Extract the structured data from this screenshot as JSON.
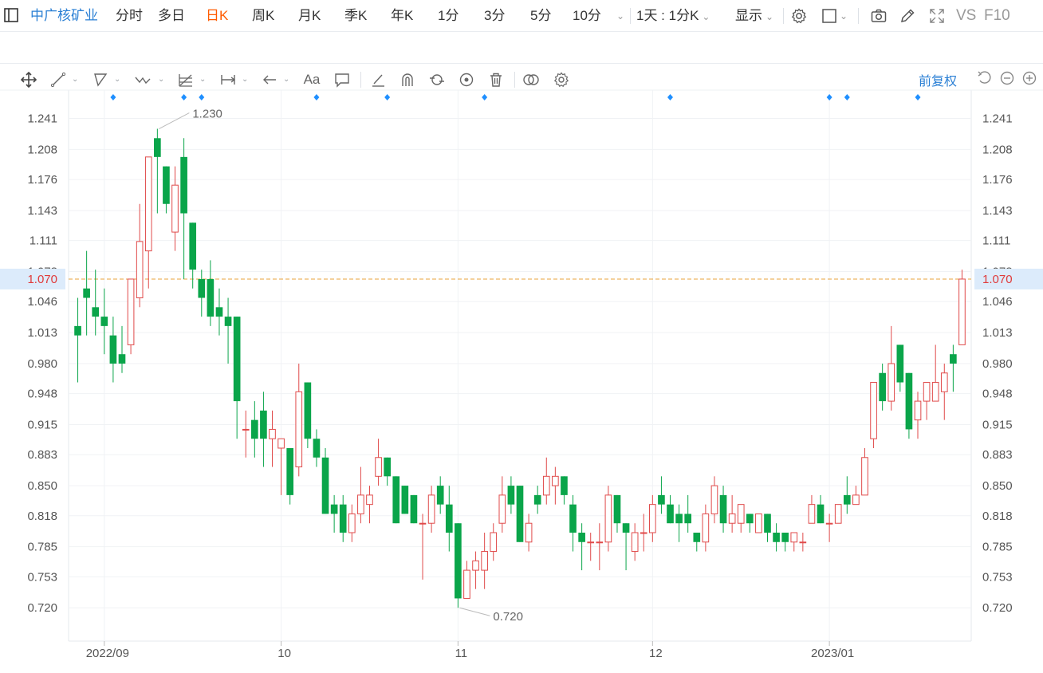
{
  "header": {
    "stock_name": "中广核矿业",
    "periods": [
      "分时",
      "多日",
      "日K",
      "周K",
      "月K",
      "季K",
      "年K",
      "1分",
      "3分",
      "5分",
      "10分"
    ],
    "active_period": "日K",
    "interval_label": "1天 : 1分K",
    "display_label": "显示",
    "vs_label": "VS",
    "f10_label": "F10"
  },
  "toolbar2_icons": [
    "crosshair-move-icon",
    "line-tool-icon",
    "polyline-tool-icon",
    "wave-tool-icon",
    "fib-tool-icon",
    "measure-tool-icon",
    "arrow-tool-icon",
    "text-tool-icon",
    "comment-tool-icon",
    "brush-tool-icon",
    "magnet-tool-icon",
    "sync-tool-icon",
    "eye-icon",
    "trash-icon",
    "compare-icon",
    "settings-icon"
  ],
  "adjust_label": "前复权",
  "chart_data": {
    "type": "candlestick",
    "title": "",
    "ylim": [
      0.71,
      1.261
    ],
    "yticks": [
      "1.241",
      "1.208",
      "1.176",
      "1.143",
      "1.111",
      "1.078",
      "1.046",
      "1.013",
      "0.980",
      "0.948",
      "0.915",
      "0.883",
      "0.850",
      "0.818",
      "0.785",
      "0.753",
      "0.720"
    ],
    "x_labels": [
      {
        "index": 3,
        "label": "2022/09"
      },
      {
        "index": 23,
        "label": "10"
      },
      {
        "index": 43,
        "label": "11"
      },
      {
        "index": 65,
        "label": "12"
      },
      {
        "index": 85,
        "label": "2023/01"
      }
    ],
    "current_price": "1.070",
    "annotations": [
      {
        "label": "1.230",
        "index": 9,
        "value": 1.23
      },
      {
        "label": "0.720",
        "index": 43,
        "value": 0.72
      }
    ],
    "event_marker_indices": [
      4,
      12,
      14,
      27,
      35,
      46,
      67,
      85,
      87,
      95
    ],
    "colors": {
      "up": "#e04a4a",
      "down": "#0aa54a",
      "current_line": "#e8a33b",
      "current_bg": "#dcebfb"
    },
    "candles": [
      {
        "o": 1.02,
        "h": 1.05,
        "l": 0.96,
        "c": 1.01
      },
      {
        "o": 1.06,
        "h": 1.1,
        "l": 1.01,
        "c": 1.05
      },
      {
        "o": 1.04,
        "h": 1.08,
        "l": 1.01,
        "c": 1.03
      },
      {
        "o": 1.03,
        "h": 1.06,
        "l": 0.99,
        "c": 1.02
      },
      {
        "o": 1.01,
        "h": 1.03,
        "l": 0.96,
        "c": 0.98
      },
      {
        "o": 0.99,
        "h": 1.02,
        "l": 0.97,
        "c": 0.98
      },
      {
        "o": 1.0,
        "h": 1.07,
        "l": 0.99,
        "c": 1.07
      },
      {
        "o": 1.05,
        "h": 1.15,
        "l": 1.04,
        "c": 1.11
      },
      {
        "o": 1.1,
        "h": 1.2,
        "l": 1.06,
        "c": 1.2
      },
      {
        "o": 1.22,
        "h": 1.23,
        "l": 1.14,
        "c": 1.2
      },
      {
        "o": 1.19,
        "h": 1.19,
        "l": 1.14,
        "c": 1.15
      },
      {
        "o": 1.12,
        "h": 1.19,
        "l": 1.1,
        "c": 1.17
      },
      {
        "o": 1.2,
        "h": 1.22,
        "l": 1.07,
        "c": 1.14
      },
      {
        "o": 1.13,
        "h": 1.13,
        "l": 1.06,
        "c": 1.08
      },
      {
        "o": 1.07,
        "h": 1.08,
        "l": 1.03,
        "c": 1.05
      },
      {
        "o": 1.07,
        "h": 1.09,
        "l": 1.02,
        "c": 1.03
      },
      {
        "o": 1.04,
        "h": 1.06,
        "l": 1.01,
        "c": 1.03
      },
      {
        "o": 1.03,
        "h": 1.05,
        "l": 0.98,
        "c": 1.02
      },
      {
        "o": 1.03,
        "h": 1.03,
        "l": 0.9,
        "c": 0.94
      },
      {
        "o": 0.91,
        "h": 0.93,
        "l": 0.88,
        "c": 0.91
      },
      {
        "o": 0.92,
        "h": 0.94,
        "l": 0.88,
        "c": 0.9
      },
      {
        "o": 0.93,
        "h": 0.95,
        "l": 0.87,
        "c": 0.9
      },
      {
        "o": 0.9,
        "h": 0.93,
        "l": 0.87,
        "c": 0.91
      },
      {
        "o": 0.89,
        "h": 0.9,
        "l": 0.84,
        "c": 0.9
      },
      {
        "o": 0.89,
        "h": 0.89,
        "l": 0.83,
        "c": 0.84
      },
      {
        "o": 0.87,
        "h": 0.98,
        "l": 0.86,
        "c": 0.95
      },
      {
        "o": 0.96,
        "h": 0.96,
        "l": 0.89,
        "c": 0.9
      },
      {
        "o": 0.9,
        "h": 0.91,
        "l": 0.87,
        "c": 0.88
      },
      {
        "o": 0.88,
        "h": 0.89,
        "l": 0.82,
        "c": 0.82
      },
      {
        "o": 0.83,
        "h": 0.84,
        "l": 0.8,
        "c": 0.82
      },
      {
        "o": 0.83,
        "h": 0.84,
        "l": 0.79,
        "c": 0.8
      },
      {
        "o": 0.8,
        "h": 0.83,
        "l": 0.79,
        "c": 0.82
      },
      {
        "o": 0.82,
        "h": 0.87,
        "l": 0.81,
        "c": 0.84
      },
      {
        "o": 0.83,
        "h": 0.85,
        "l": 0.81,
        "c": 0.84
      },
      {
        "o": 0.86,
        "h": 0.9,
        "l": 0.85,
        "c": 0.88
      },
      {
        "o": 0.88,
        "h": 0.88,
        "l": 0.85,
        "c": 0.86
      },
      {
        "o": 0.86,
        "h": 0.86,
        "l": 0.81,
        "c": 0.81
      },
      {
        "o": 0.85,
        "h": 0.85,
        "l": 0.82,
        "c": 0.82
      },
      {
        "o": 0.84,
        "h": 0.84,
        "l": 0.81,
        "c": 0.81
      },
      {
        "o": 0.81,
        "h": 0.82,
        "l": 0.75,
        "c": 0.81
      },
      {
        "o": 0.81,
        "h": 0.85,
        "l": 0.8,
        "c": 0.84
      },
      {
        "o": 0.85,
        "h": 0.86,
        "l": 0.82,
        "c": 0.83
      },
      {
        "o": 0.83,
        "h": 0.85,
        "l": 0.78,
        "c": 0.8
      },
      {
        "o": 0.81,
        "h": 0.81,
        "l": 0.72,
        "c": 0.73
      },
      {
        "o": 0.73,
        "h": 0.77,
        "l": 0.73,
        "c": 0.76
      },
      {
        "o": 0.76,
        "h": 0.78,
        "l": 0.74,
        "c": 0.77
      },
      {
        "o": 0.76,
        "h": 0.8,
        "l": 0.74,
        "c": 0.78
      },
      {
        "o": 0.78,
        "h": 0.81,
        "l": 0.77,
        "c": 0.8
      },
      {
        "o": 0.81,
        "h": 0.86,
        "l": 0.8,
        "c": 0.84
      },
      {
        "o": 0.85,
        "h": 0.86,
        "l": 0.82,
        "c": 0.83
      },
      {
        "o": 0.85,
        "h": 0.85,
        "l": 0.79,
        "c": 0.79
      },
      {
        "o": 0.79,
        "h": 0.82,
        "l": 0.78,
        "c": 0.81
      },
      {
        "o": 0.84,
        "h": 0.85,
        "l": 0.82,
        "c": 0.83
      },
      {
        "o": 0.84,
        "h": 0.88,
        "l": 0.83,
        "c": 0.86
      },
      {
        "o": 0.85,
        "h": 0.87,
        "l": 0.83,
        "c": 0.86
      },
      {
        "o": 0.86,
        "h": 0.86,
        "l": 0.83,
        "c": 0.84
      },
      {
        "o": 0.83,
        "h": 0.84,
        "l": 0.78,
        "c": 0.8
      },
      {
        "o": 0.8,
        "h": 0.81,
        "l": 0.76,
        "c": 0.79
      },
      {
        "o": 0.79,
        "h": 0.8,
        "l": 0.77,
        "c": 0.79
      },
      {
        "o": 0.79,
        "h": 0.81,
        "l": 0.76,
        "c": 0.79
      },
      {
        "o": 0.79,
        "h": 0.85,
        "l": 0.78,
        "c": 0.84
      },
      {
        "o": 0.84,
        "h": 0.84,
        "l": 0.8,
        "c": 0.81
      },
      {
        "o": 0.81,
        "h": 0.81,
        "l": 0.76,
        "c": 0.8
      },
      {
        "o": 0.78,
        "h": 0.81,
        "l": 0.77,
        "c": 0.8
      },
      {
        "o": 0.8,
        "h": 0.82,
        "l": 0.78,
        "c": 0.8
      },
      {
        "o": 0.8,
        "h": 0.84,
        "l": 0.79,
        "c": 0.83
      },
      {
        "o": 0.84,
        "h": 0.86,
        "l": 0.82,
        "c": 0.83
      },
      {
        "o": 0.83,
        "h": 0.84,
        "l": 0.81,
        "c": 0.81
      },
      {
        "o": 0.82,
        "h": 0.83,
        "l": 0.79,
        "c": 0.81
      },
      {
        "o": 0.82,
        "h": 0.84,
        "l": 0.8,
        "c": 0.81
      },
      {
        "o": 0.8,
        "h": 0.8,
        "l": 0.78,
        "c": 0.79
      },
      {
        "o": 0.79,
        "h": 0.83,
        "l": 0.78,
        "c": 0.82
      },
      {
        "o": 0.82,
        "h": 0.86,
        "l": 0.81,
        "c": 0.85
      },
      {
        "o": 0.84,
        "h": 0.85,
        "l": 0.8,
        "c": 0.81
      },
      {
        "o": 0.81,
        "h": 0.84,
        "l": 0.8,
        "c": 0.82
      },
      {
        "o": 0.81,
        "h": 0.83,
        "l": 0.8,
        "c": 0.83
      },
      {
        "o": 0.82,
        "h": 0.82,
        "l": 0.8,
        "c": 0.81
      },
      {
        "o": 0.8,
        "h": 0.82,
        "l": 0.8,
        "c": 0.82
      },
      {
        "o": 0.82,
        "h": 0.82,
        "l": 0.79,
        "c": 0.8
      },
      {
        "o": 0.8,
        "h": 0.81,
        "l": 0.78,
        "c": 0.79
      },
      {
        "o": 0.8,
        "h": 0.8,
        "l": 0.78,
        "c": 0.79
      },
      {
        "o": 0.79,
        "h": 0.8,
        "l": 0.78,
        "c": 0.8
      },
      {
        "o": 0.79,
        "h": 0.8,
        "l": 0.78,
        "c": 0.79
      },
      {
        "o": 0.81,
        "h": 0.84,
        "l": 0.81,
        "c": 0.83
      },
      {
        "o": 0.83,
        "h": 0.84,
        "l": 0.81,
        "c": 0.81
      },
      {
        "o": 0.81,
        "h": 0.82,
        "l": 0.79,
        "c": 0.81
      },
      {
        "o": 0.81,
        "h": 0.83,
        "l": 0.81,
        "c": 0.83
      },
      {
        "o": 0.84,
        "h": 0.86,
        "l": 0.82,
        "c": 0.83
      },
      {
        "o": 0.83,
        "h": 0.85,
        "l": 0.83,
        "c": 0.84
      },
      {
        "o": 0.84,
        "h": 0.89,
        "l": 0.84,
        "c": 0.88
      },
      {
        "o": 0.9,
        "h": 0.96,
        "l": 0.89,
        "c": 0.96
      },
      {
        "o": 0.97,
        "h": 0.98,
        "l": 0.93,
        "c": 0.94
      },
      {
        "o": 0.94,
        "h": 1.02,
        "l": 0.93,
        "c": 0.98
      },
      {
        "o": 1.0,
        "h": 1.0,
        "l": 0.95,
        "c": 0.96
      },
      {
        "o": 0.97,
        "h": 0.97,
        "l": 0.9,
        "c": 0.91
      },
      {
        "o": 0.92,
        "h": 0.95,
        "l": 0.9,
        "c": 0.94
      },
      {
        "o": 0.94,
        "h": 0.96,
        "l": 0.92,
        "c": 0.96
      },
      {
        "o": 0.94,
        "h": 1.0,
        "l": 0.94,
        "c": 0.96
      },
      {
        "o": 0.95,
        "h": 0.98,
        "l": 0.92,
        "c": 0.97
      },
      {
        "o": 0.99,
        "h": 1.0,
        "l": 0.95,
        "c": 0.98
      },
      {
        "o": 1.0,
        "h": 1.08,
        "l": 1.0,
        "c": 1.07
      }
    ]
  }
}
